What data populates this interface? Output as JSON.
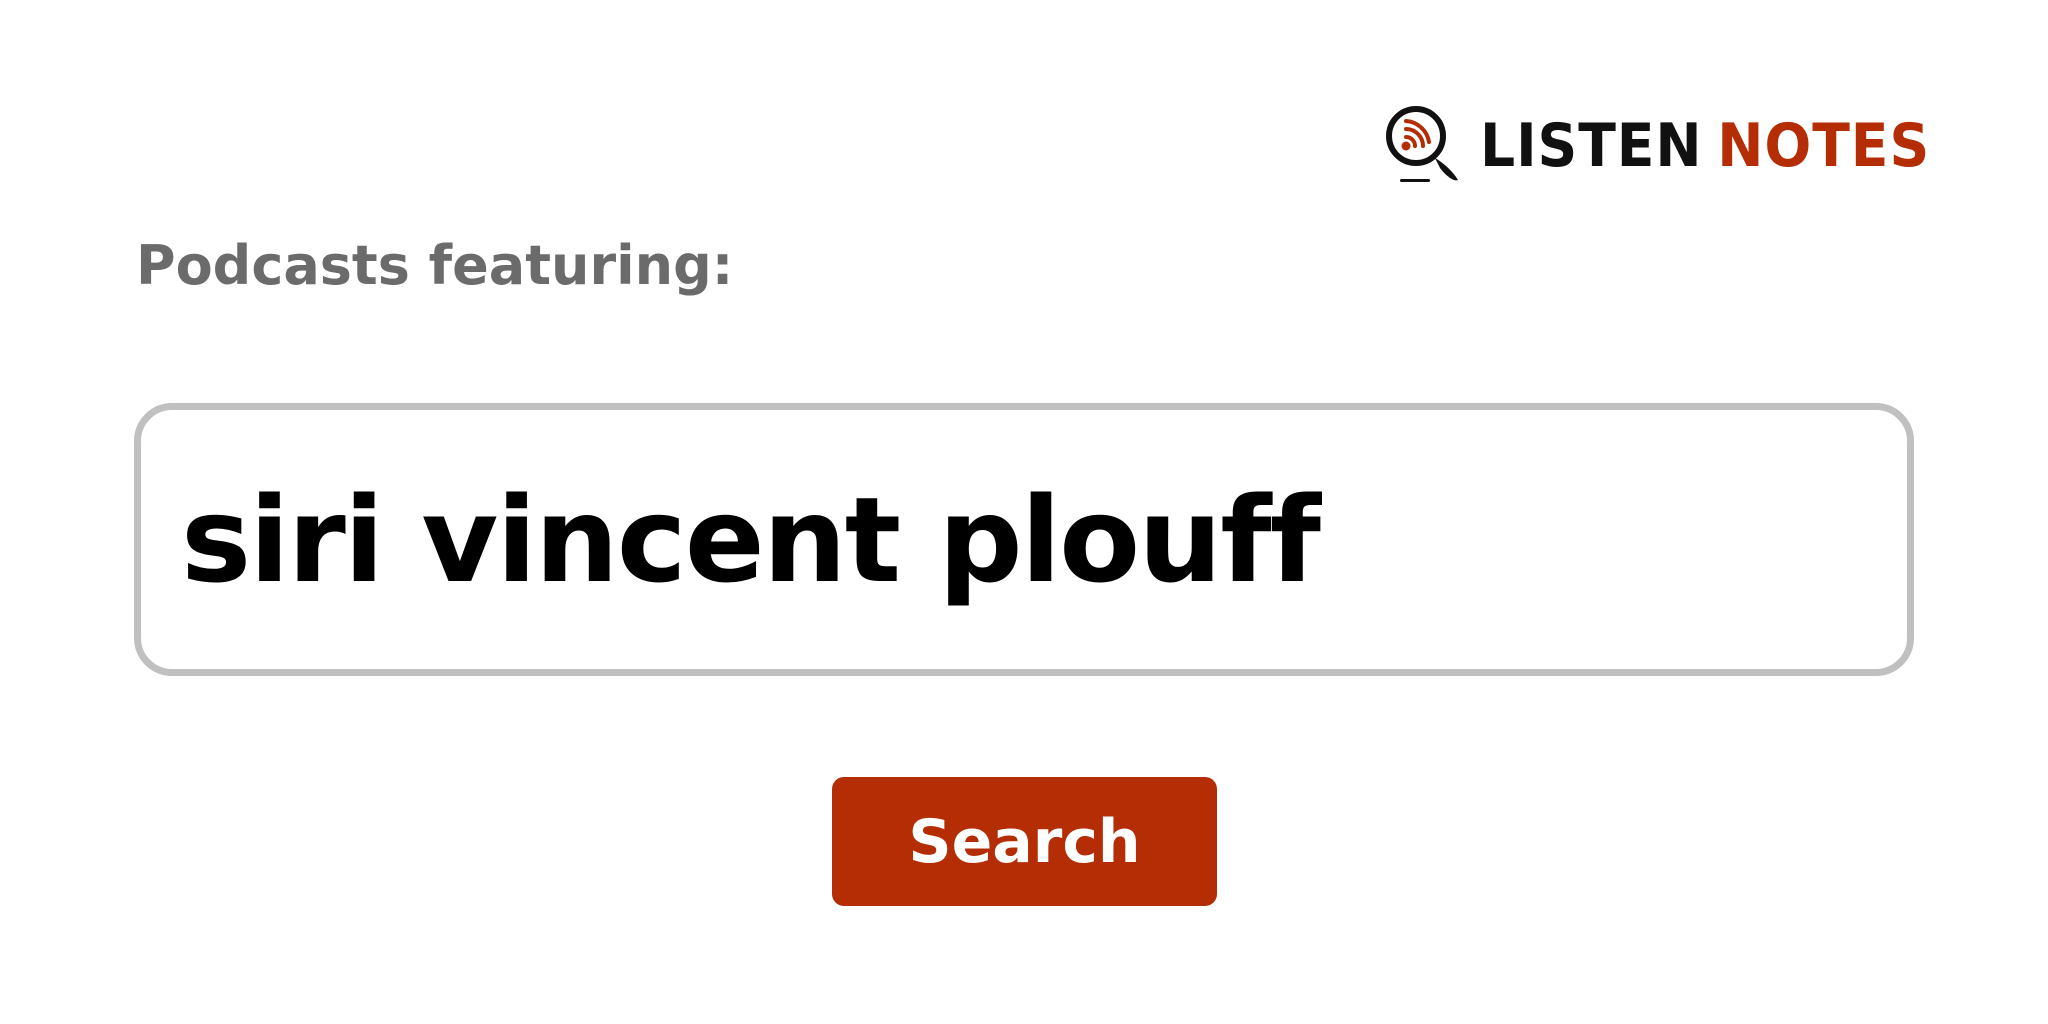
{
  "brand": {
    "word1": "LISTEN",
    "word2": "NOTES",
    "icon": "podcast-search-icon",
    "colors": {
      "dark": "#111111",
      "accent": "#b42d04"
    }
  },
  "form": {
    "prefix_label": "Podcasts featuring:",
    "query_value": "siri vincent plouff",
    "search_button_label": "Search"
  },
  "colors": {
    "label_gray": "#6b6b6b",
    "input_border": "#c0c0c0",
    "button_bg": "#b42d04",
    "button_text": "#ffffff"
  }
}
